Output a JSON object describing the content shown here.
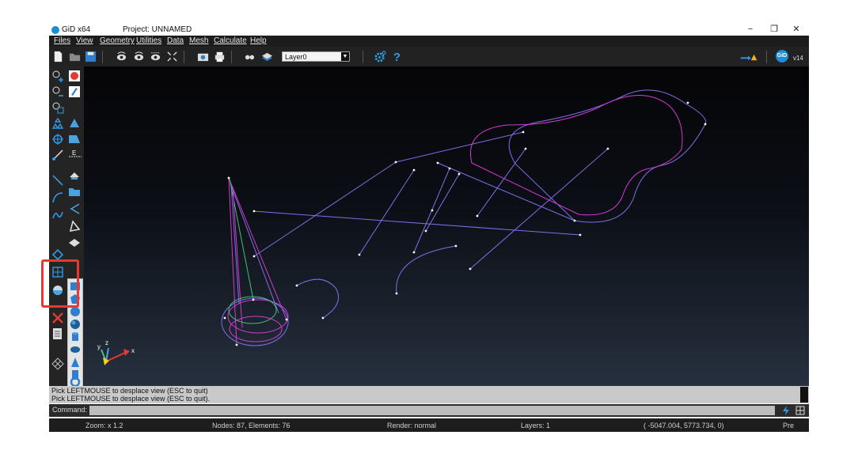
{
  "window": {
    "app_title": "GiD x64",
    "project_title": "Project: UNNAMED",
    "controls": [
      "−",
      "❐",
      "✕"
    ]
  },
  "menu": [
    "Files",
    "View",
    "Geometry",
    "Utilities",
    "Data",
    "Mesh",
    "Calculate",
    "Help"
  ],
  "toolbar": {
    "layer_selected": "Layer0",
    "version": "v14",
    "logo_text": "GiD"
  },
  "viewport": {
    "axes": {
      "x": "x",
      "y": "y",
      "z": "z"
    },
    "colors": {
      "purple": "#7f6fe8",
      "magenta": "#d23ad2",
      "green": "#45c07a",
      "node": "#ffffff"
    }
  },
  "messages": {
    "line1": "Pick LEFTMOUSE to desplace view (ESC to quit)",
    "line2": "Pick LEFTMOUSE to desplace view (ESC to quit)."
  },
  "command": {
    "label": "Command:",
    "value": ""
  },
  "status": {
    "zoom": "Zoom: x 1.2",
    "nodes": "Nodes: 87, Elements: 76",
    "render": "Render: normal",
    "layers": "Layers: 1",
    "coords": "( -5047.004,  5773.734,  0)",
    "mode": "Pre"
  }
}
